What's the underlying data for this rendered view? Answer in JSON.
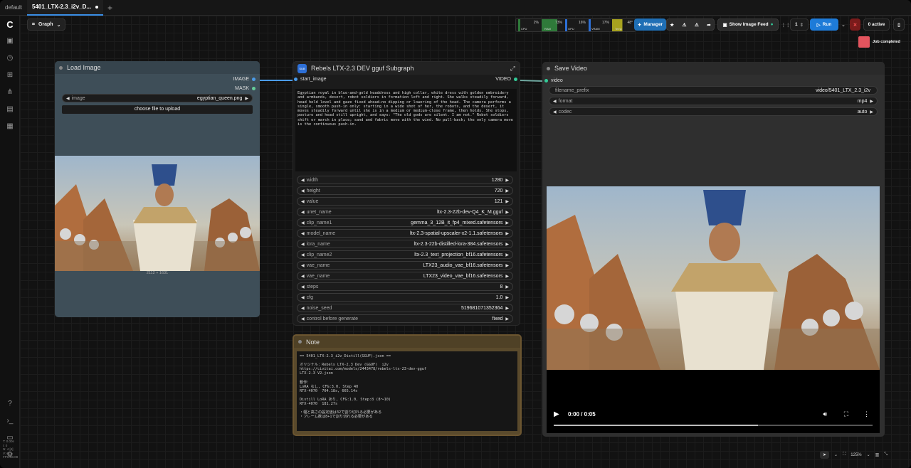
{
  "tabs": [
    {
      "label": "default"
    },
    {
      "label": "5401_LTX-2.3_i2v_D..."
    }
  ],
  "toolbar": {
    "graph_label": "Graph",
    "stats": [
      {
        "label": "CPU",
        "value": "2%",
        "color": "#2f7a3a"
      },
      {
        "label": "RAM",
        "value": "73%",
        "color": "#2f7a3a"
      },
      {
        "label": "GPU",
        "value": "16%",
        "color": "#2d6fd6"
      },
      {
        "label": "VRAM",
        "value": "17%",
        "color": "#2d6fd6"
      },
      {
        "label": "Temp",
        "value": "48°",
        "color": "#a7a21f"
      }
    ],
    "manager_label": "Manager",
    "image_feed_label": "Show Image Feed",
    "run_count": "1",
    "run_label": "Run",
    "active_label": "0 active",
    "toast_label": "Job completed"
  },
  "load_image": {
    "title": "Load Image",
    "out_image": "IMAGE",
    "out_mask": "MASK",
    "image_label": "image",
    "image_value": "egyptian_queen.png",
    "upload_label": "choose file to upload",
    "dimensions": "2112 × 1631"
  },
  "subgraph": {
    "title": "Rebels LTX-2.3 DEV gguf Subgraph",
    "input": "start_image",
    "output": "VIDEO",
    "prompt": "Egyptian royal in blue-and-gold headdress and high collar, white dress with golden embroidery and armbands, desert, robot soldiers in formation left and right. She walks steadily forward, head held level and gaze fixed ahead—no dipping or lowering of the head. The camera performs a single, smooth push-in only: starting in a wide shot of her, the robots, and the desert, it moves steadily forward until she is in a medium or medium-close frame, then holds. She stops, posture and head still upright, and says: \"The old gods are silent. I am not.\" Robot soldiers shift or march in place; sand and fabric move with the wind. No pull-back; the only camera move is the continuous push-in.",
    "widgets": [
      {
        "label": "width",
        "value": "1280"
      },
      {
        "label": "height",
        "value": "720"
      },
      {
        "label": "value",
        "value": "121"
      },
      {
        "label": "unet_name",
        "value": "ltx-2.3-22b-dev-Q4_K_M.gguf"
      },
      {
        "label": "clip_name1",
        "value": "gemma_3_12B_it_fp4_mixed.safetensors"
      },
      {
        "label": "model_name",
        "value": "ltx-2.3-spatial-upscaler-x2-1.1.safetensors"
      },
      {
        "label": "lora_name",
        "value": "ltx-2.3-22b-distilled-lora-384.safetensors"
      },
      {
        "label": "clip_name2",
        "value": "ltx-2.3_text_projection_bf16.safetensors"
      },
      {
        "label": "vae_name",
        "value": "LTX23_audio_vae_bf16.safetensors"
      },
      {
        "label": "vae_name",
        "value": "LTX23_video_vae_bf16.safetensors"
      },
      {
        "label": "steps",
        "value": "8"
      },
      {
        "label": "cfg",
        "value": "1.0"
      },
      {
        "label": "noise_seed",
        "value": "519681071352364"
      },
      {
        "label": "control before generate",
        "value": "fixed"
      }
    ]
  },
  "note": {
    "title": "Note",
    "text": "== 5401_LTX-2.3_i2v_Distill(GGUF).json ==\n\nオリジナル：Rebels LTX-2.3 Dev (GGUF)  i2v\nhttps://civitai.com/models/2443478/rebels-ltx-23-dev-gguf\nLTX-2.3 V2.json\n\n動作：\nLoRA なし, CFG:3.0, Step 40\nRTX-4070  704.18s, 665.14s\n\nDistill LoRA あり, CFG:1.0, Step:8 (8～10)\nRTX-4070  181.27s\n\n・幅と高さの設定値は32で割り切れる必要がある\n・フレーム数は8+1で割り切れる必要がある"
  },
  "save_video": {
    "title": "Save Video",
    "input": "video",
    "widgets": [
      {
        "label": "filename_prefix",
        "value": "video/5401_LTX_2.3_i2v"
      },
      {
        "label": "format",
        "value": "mp4"
      },
      {
        "label": "codec",
        "value": "auto"
      }
    ],
    "time": "0:00 / 0:05",
    "progress": 0.64
  },
  "sidebar_stats": "T: 0.00s\nI: 0\nN: 4 [4]\nV: 6\nFPS:60.00",
  "zoom": "125%"
}
